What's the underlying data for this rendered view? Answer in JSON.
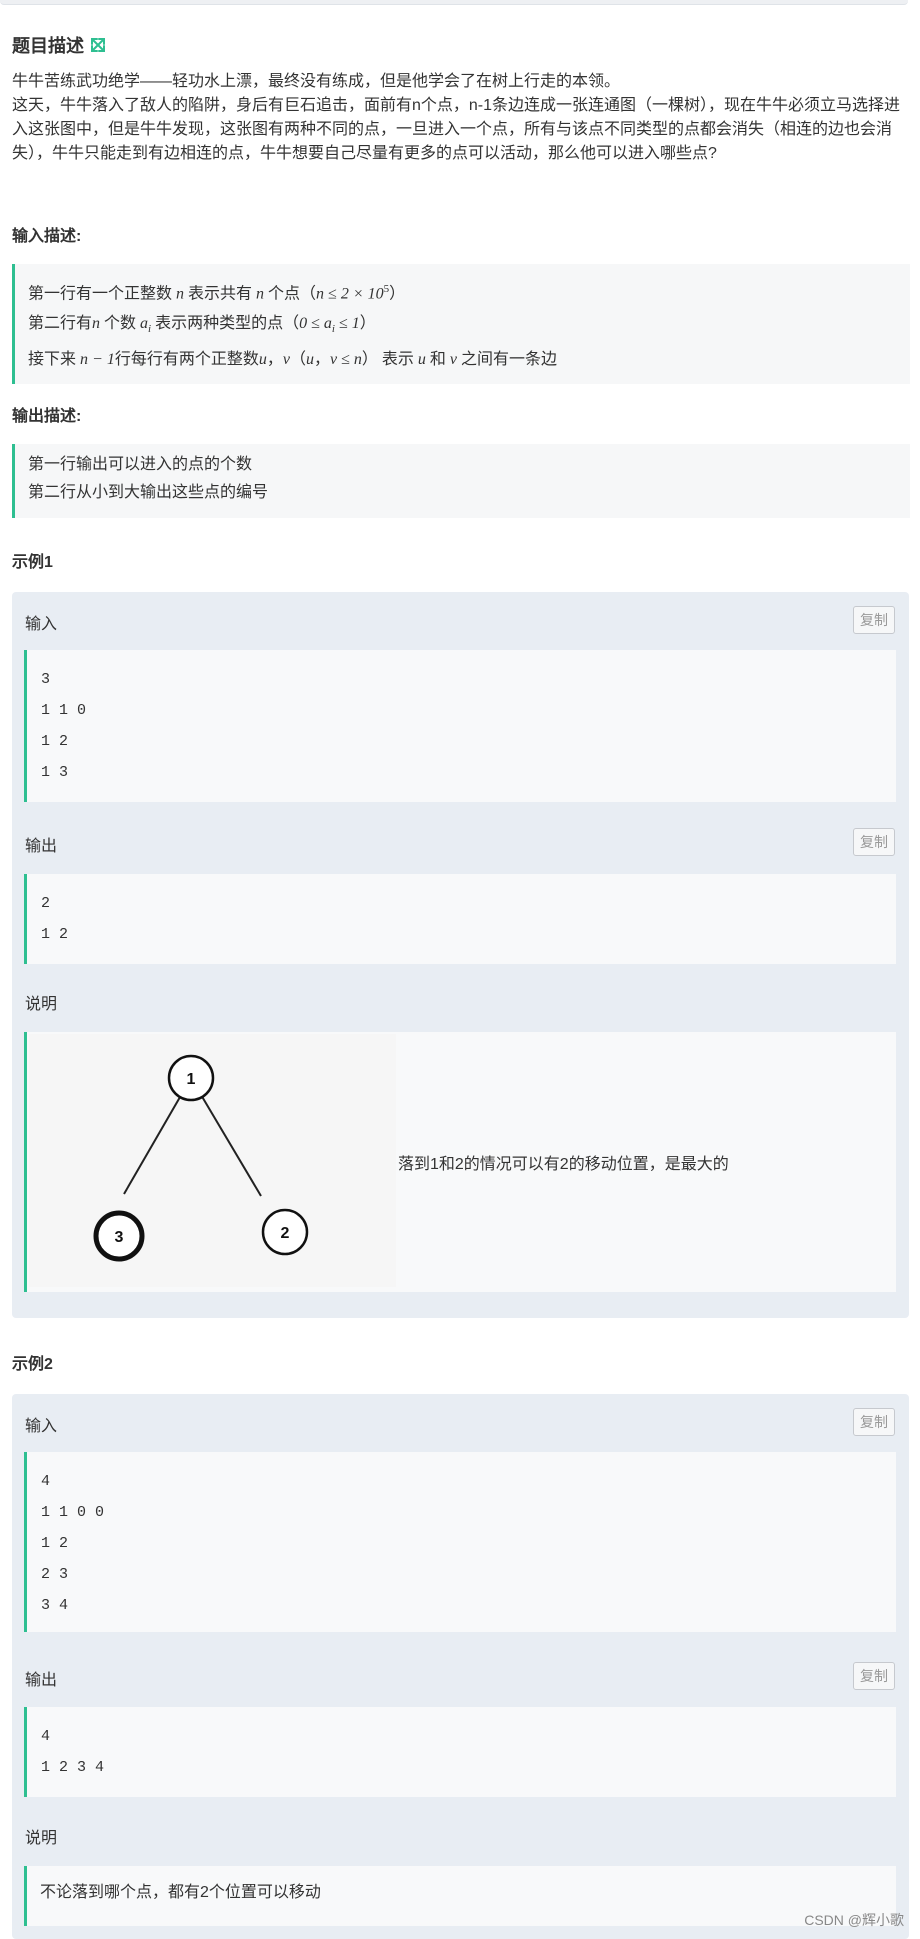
{
  "problem": {
    "title": "题目描述",
    "description": [
      "牛牛苦练武功绝学——轻功水上漂，最终没有练成，但是他学会了在树上行走的本领。",
      "这天，牛牛落入了敌人的陷阱，身后有巨石追击，面前有n个点，n-1条边连成一张连通图（一棵树），现在牛牛必须立马选择进入这张图中，但是牛牛发现，这张图有两种不同的点，一旦进入一个点，所有与该点不同类型的点都会消失（相连的边也会消失），牛牛只能走到有边相连的点，牛牛想要自己尽量有更多的点可以活动，那么他可以进入哪些点?"
    ]
  },
  "input_section": {
    "title": "输入描述:",
    "line1": {
      "a": "第一行有一个正整数 ",
      "b": "n",
      "c": " 表示共有 ",
      "d": "n",
      "e": " 个点（",
      "f": "n ≤ 2 × 10",
      "g": "5",
      "h": "）"
    },
    "line2": {
      "a": "第二行有",
      "b": "n",
      "c": " 个数 ",
      "d": "a",
      "e": "i",
      "f": " 表示两种类型的点（",
      "g": "0 ≤ a",
      "h": "i",
      "i": " ≤ 1",
      "j": "）"
    },
    "line3": {
      "a": "接下来 ",
      "b": "n − 1",
      "c": "行每行有两个正整数",
      "d": "u",
      "e": "，",
      "f": "v",
      "g": "（",
      "h": "u",
      "i": "，",
      "j": "v ≤ n",
      "k": "） 表示 ",
      "l": "u",
      "m": " 和 ",
      "n": "v",
      "o": " 之间有一条边"
    }
  },
  "output_section": {
    "title": "输出描述:",
    "lines": [
      "第一行输出可以进入的点的个数",
      "第二行从小到大输出这些点的编号"
    ]
  },
  "examples": [
    {
      "title": "示例1",
      "input_label": "输入",
      "input_lines": [
        "3",
        "1 1 0",
        "1 2",
        "1 3"
      ],
      "output_label": "输出",
      "output_lines": [
        "2",
        "1 2"
      ],
      "explain_label": "说明",
      "explain_text": "落到1和2的情况可以有2的移动位置，是最大的",
      "tree": {
        "nodes": [
          "1",
          "2",
          "3"
        ]
      }
    },
    {
      "title": "示例2",
      "input_label": "输入",
      "input_lines": [
        "4",
        "1 1 0 0",
        "1 2",
        "2 3",
        "3 4"
      ],
      "output_label": "输出",
      "output_lines": [
        "4",
        "1 2 3 4"
      ],
      "explain_label": "说明",
      "explain_text": "不论落到哪个点，都有2个位置可以移动"
    }
  ],
  "copy_label": "复制",
  "watermark": "CSDN @辉小歌",
  "colors": {
    "accent": "#2ebf91",
    "example_bg": "#e8edf3"
  }
}
